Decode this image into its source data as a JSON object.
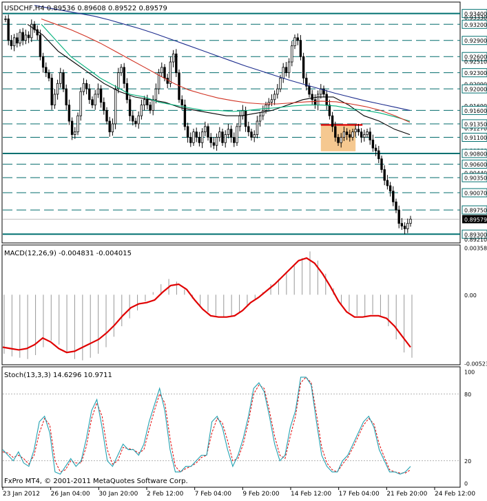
{
  "window": {
    "price_header": "USDCHF,H4  0.89536 0.89608 0.89522 0.89579",
    "macd_header": "MACD(12,26,9) -0.004831 -0.004015",
    "stoch_header": "Stoch(13,3,3) 14.6296 10.9711",
    "footer_text": "FxPro MT4, © 2001-2011 MetaQuotes Software Corp."
  },
  "colors": {
    "background": "#ffffff",
    "frame": "#000000",
    "candle": "#000000",
    "level_line": "#006b6b",
    "strong_level": "#007070",
    "ma_fast": "#000000",
    "ma_green": "#00b07a",
    "ma_red": "#d03020",
    "ma_blue": "#1a2a8c",
    "box_fill": "#f5c890",
    "box_top": "#e01010",
    "macd_hist": "#a0a0a0",
    "macd_signal": "#e00000",
    "stoch_main": "#20a0b0",
    "stoch_signal": "#e00000"
  },
  "chart_data": [
    {
      "type": "candlestick",
      "title": "USDCHF,H4",
      "x_tick_labels": [
        "23 Jan 2012",
        "26 Jan 04:00",
        "30 Jan 20:00",
        "2 Feb 12:00",
        "7 Feb 04:00",
        "9 Feb 20:00",
        "14 Feb 12:00",
        "17 Feb 04:00",
        "21 Feb 20:00",
        "24 Feb 12:00"
      ],
      "ylim": [
        0.8915,
        0.936
      ],
      "horizontal_levels": [
        "0.93400",
        "0.93200",
        "0.92900",
        "0.92600",
        "0.92300",
        "0.92000",
        "0.91600",
        "0.91350",
        "0.91100",
        "0.90800",
        "0.90600",
        "0.90350",
        "0.90070",
        "0.89750",
        "0.89300"
      ],
      "right_axis_labels": [
        "0.93400",
        "0.93330",
        "0.93200",
        "0.92900",
        "0.92600",
        "0.92510",
        "0.92300",
        "0.92090",
        "0.92000",
        "0.91690",
        "0.91600",
        "0.91270",
        "0.91350",
        "0.91100",
        "0.90860",
        "0.90800",
        "0.90600",
        "0.90440",
        "0.90350",
        "0.90070",
        "0.89750",
        "0.89579",
        "0.89300",
        "0.89210"
      ],
      "current_price": "0.89579",
      "consolidation_box": {
        "top": 0.9133,
        "bottom": 0.9084
      },
      "moving_averages": [
        "black",
        "green",
        "red",
        "blue"
      ],
      "close_path": [
        0.933,
        0.929,
        0.928,
        0.9295,
        0.9285,
        0.9305,
        0.929,
        0.93,
        0.9295,
        0.932,
        0.931,
        0.93,
        0.926,
        0.924,
        0.923,
        0.922,
        0.917,
        0.919,
        0.921,
        0.923,
        0.92,
        0.917,
        0.914,
        0.9115,
        0.912,
        0.915,
        0.9195,
        0.921,
        0.92,
        0.918,
        0.917,
        0.919,
        0.92,
        0.9175,
        0.916,
        0.914,
        0.912,
        0.9135,
        0.92,
        0.923,
        0.924,
        0.921,
        0.918,
        0.915,
        0.914,
        0.9135,
        0.915,
        0.917,
        0.918,
        0.917,
        0.916,
        0.918,
        0.92,
        0.923,
        0.924,
        0.922,
        0.921,
        0.925,
        0.9265,
        0.923,
        0.918,
        0.917,
        0.913,
        0.911,
        0.91,
        0.912,
        0.911,
        0.91,
        0.912,
        0.913,
        0.911,
        0.91,
        0.9095,
        0.911,
        0.912,
        0.91,
        0.9115,
        0.9125,
        0.911,
        0.91,
        0.913,
        0.915,
        0.916,
        0.913,
        0.912,
        0.911,
        0.9115,
        0.914,
        0.915,
        0.916,
        0.917,
        0.9175,
        0.918,
        0.919,
        0.92,
        0.922,
        0.924,
        0.923,
        0.925,
        0.928,
        0.9295,
        0.929,
        0.926,
        0.922,
        0.9205,
        0.919,
        0.918,
        0.917,
        0.919,
        0.92,
        0.919,
        0.917,
        0.915,
        0.913,
        0.911,
        0.91,
        0.911,
        0.912,
        0.9115,
        0.911,
        0.912,
        0.9125,
        0.912,
        0.911,
        0.9115,
        0.912,
        0.9105,
        0.909,
        0.9085,
        0.907,
        0.905,
        0.903,
        0.902,
        0.901,
        0.899,
        0.8975,
        0.895,
        0.8945,
        0.894,
        0.895,
        0.8958
      ],
      "ma_values": {
        "black": [
          0.932,
          0.93,
          0.927,
          0.925,
          0.923,
          0.921,
          0.9195,
          0.9185,
          0.918,
          0.9175,
          0.9165,
          0.916,
          0.9155,
          0.915,
          0.915,
          0.9155,
          0.916,
          0.917,
          0.918,
          0.9185,
          0.9185,
          0.917,
          0.915,
          0.914,
          0.9125,
          0.9115
        ],
        "green": [
          0.932,
          0.929,
          0.926,
          0.924,
          0.922,
          0.9205,
          0.919,
          0.9185,
          0.9175,
          0.917,
          0.9165,
          0.916,
          0.916,
          0.9158,
          0.916,
          0.9163,
          0.9165,
          0.9168,
          0.917,
          0.917,
          0.9168,
          0.9163,
          0.916,
          0.9155,
          0.9148,
          0.914
        ],
        "red": [
          0.933,
          0.932,
          0.931,
          0.9298,
          0.9285,
          0.927,
          0.9255,
          0.924,
          0.9225,
          0.921,
          0.9198,
          0.919,
          0.9183,
          0.9178,
          0.9174,
          0.9172,
          0.9172,
          0.9174,
          0.9176,
          0.9177,
          0.9176,
          0.9172,
          0.9167,
          0.916,
          0.915,
          0.9138
        ],
        "blue": [
          0.9355,
          0.935,
          0.9345,
          0.934,
          0.9335,
          0.9328,
          0.932,
          0.9312,
          0.9303,
          0.9293,
          0.9283,
          0.9273,
          0.9263,
          0.9253,
          0.9243,
          0.9234,
          0.9225,
          0.9216,
          0.9208,
          0.92,
          0.9192,
          0.9185,
          0.9178,
          0.9172,
          0.9166,
          0.916
        ]
      }
    },
    {
      "type": "bar",
      "title": "MACD(12,26,9)",
      "values_main": [
        -0.0045,
        -0.0047,
        -0.0048,
        -0.0049,
        -0.0046,
        -0.004,
        -0.0035,
        -0.0038,
        -0.0044,
        -0.0049,
        -0.005,
        -0.0048,
        -0.0045,
        -0.004,
        -0.0032,
        -0.0024,
        -0.0018,
        -0.0012,
        -0.0005,
        0.0002,
        0.0008,
        0.0012,
        0.001,
        0.0004,
        -0.0003,
        -0.0008,
        -0.0013,
        -0.0016,
        -0.0017,
        -0.0016,
        -0.0013,
        -0.0008,
        -0.0003,
        0.0002,
        0.0008,
        0.0012,
        0.0017,
        0.0022,
        0.0028,
        0.0033,
        0.0026,
        0.0016,
        0.0005,
        -0.0007,
        -0.0013,
        -0.0016,
        -0.0017,
        -0.0015,
        -0.0016,
        -0.0024,
        -0.0034,
        -0.0044,
        -0.0048
      ],
      "values_signal": [
        -0.004,
        -0.0041,
        -0.0042,
        -0.0041,
        -0.0038,
        -0.0033,
        -0.0036,
        -0.0041,
        -0.0044,
        -0.0043,
        -0.004,
        -0.0037,
        -0.0034,
        -0.0029,
        -0.0023,
        -0.0016,
        -0.001,
        -0.0007,
        -0.0006,
        -0.0004,
        0.0002,
        0.0007,
        0.0008,
        0.0004,
        -0.0004,
        -0.0011,
        -0.0016,
        -0.0017,
        -0.0017,
        -0.0016,
        -0.0012,
        -0.0006,
        -0.0002,
        0.0003,
        0.0008,
        0.0014,
        0.002,
        0.0026,
        0.0028,
        0.0024,
        0.0016,
        0.0006,
        -0.0005,
        -0.0013,
        -0.0017,
        -0.0017,
        -0.0016,
        -0.0016,
        -0.0018,
        -0.0024,
        -0.0032,
        -0.004
      ],
      "ylim": [
        -0.00523,
        0.00358
      ],
      "y_tick_labels": [
        "0.00358",
        "0.00",
        "-0.00523"
      ]
    },
    {
      "type": "line",
      "title": "Stoch(13,3,3)",
      "main": [
        30,
        25,
        20,
        28,
        18,
        15,
        30,
        55,
        60,
        45,
        10,
        8,
        15,
        22,
        15,
        20,
        40,
        65,
        75,
        50,
        20,
        15,
        25,
        35,
        30,
        30,
        25,
        35,
        55,
        70,
        85,
        65,
        30,
        10,
        10,
        15,
        15,
        20,
        25,
        25,
        55,
        60,
        50,
        30,
        15,
        25,
        40,
        60,
        85,
        90,
        82,
        60,
        35,
        20,
        25,
        50,
        65,
        95,
        95,
        88,
        55,
        25,
        15,
        10,
        10,
        20,
        25,
        35,
        45,
        55,
        60,
        50,
        30,
        20,
        10,
        10,
        8,
        10,
        15
      ],
      "signal": [
        28,
        27,
        23,
        25,
        22,
        17,
        25,
        45,
        58,
        52,
        20,
        10,
        12,
        20,
        18,
        18,
        33,
        58,
        72,
        60,
        30,
        17,
        20,
        32,
        31,
        30,
        27,
        30,
        48,
        65,
        80,
        72,
        40,
        15,
        10,
        13,
        15,
        18,
        23,
        25,
        45,
        58,
        54,
        38,
        20,
        22,
        35,
        55,
        80,
        88,
        85,
        65,
        42,
        25,
        22,
        42,
        60,
        90,
        95,
        90,
        62,
        32,
        18,
        12,
        10,
        17,
        23,
        32,
        42,
        52,
        58,
        53,
        35,
        23,
        12,
        10,
        9,
        9,
        12
      ],
      "ylim": [
        0,
        100
      ],
      "y_tick_labels": [
        "100",
        "80",
        "20",
        "0"
      ]
    }
  ]
}
